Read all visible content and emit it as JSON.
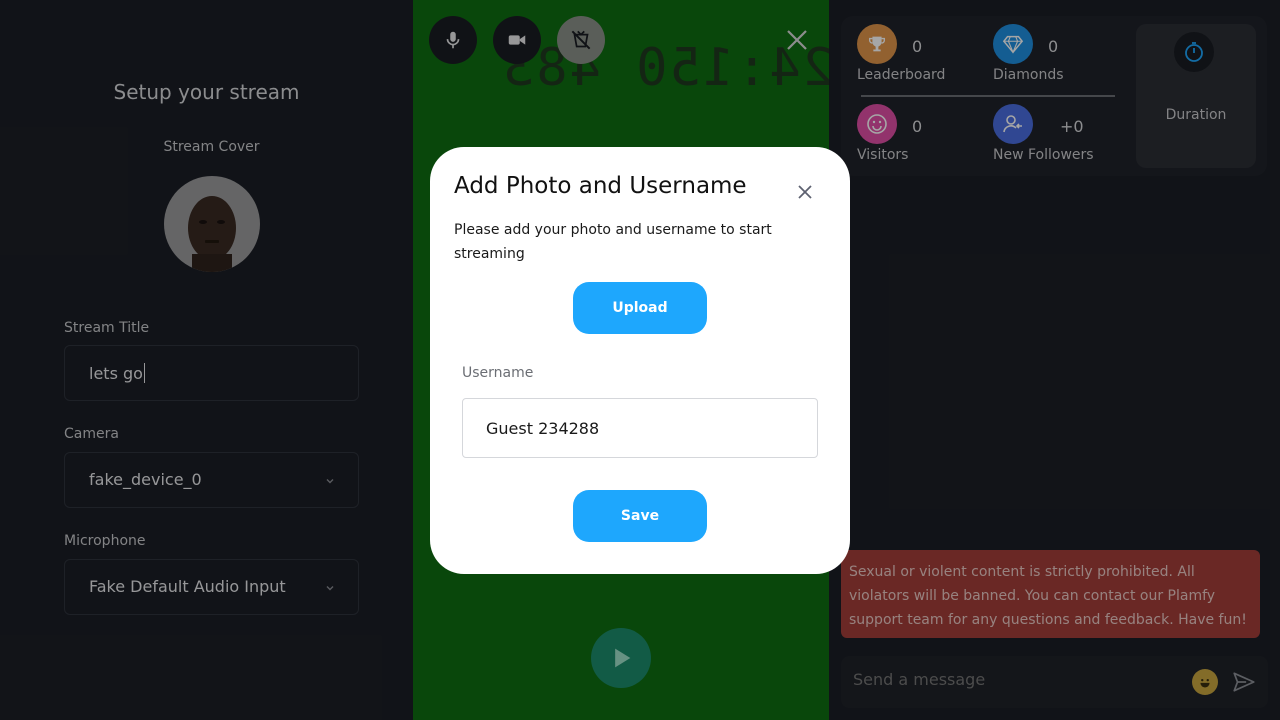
{
  "setup": {
    "title": "Setup your stream",
    "cover_label": "Stream Cover",
    "title_label": "Stream Title",
    "title_value": "lets go",
    "camera_label": "Camera",
    "camera_value": "fake_device_0",
    "mic_label": "Microphone",
    "mic_value": "Fake Default Audio Input"
  },
  "video": {
    "mirrored_overlay_text": "24:150 483",
    "controls": [
      "microphone-icon",
      "video-camera-icon",
      "beauty-filter-off-icon"
    ]
  },
  "stats": {
    "leaderboard_value": "0",
    "leaderboard_label": "Leaderboard",
    "diamonds_value": "0",
    "diamonds_label": "Diamonds",
    "visitors_value": "0",
    "visitors_label": "Visitors",
    "followers_value": "+0",
    "followers_label": "New Followers",
    "duration_label": "Duration"
  },
  "chat": {
    "warning": "Sexual or violent content is strictly prohibited. All violators will be banned. You can contact our Plamfy support team for any questions and feedback. Have fun!",
    "placeholder": "Send a message"
  },
  "modal": {
    "title": "Add Photo and Username",
    "description": "Please add your photo and username to start streaming",
    "upload_label": "Upload",
    "username_label": "Username",
    "username_value": "Guest 234288",
    "save_label": "Save"
  },
  "colors": {
    "accent_blue": "#1ea7fd",
    "video_green": "#0f6e12",
    "warning_red": "#a33e3a",
    "leaderboard": "#e0954a",
    "diamonds": "#1f8fe0",
    "visitors": "#e04fa7",
    "followers": "#4a6de0"
  }
}
